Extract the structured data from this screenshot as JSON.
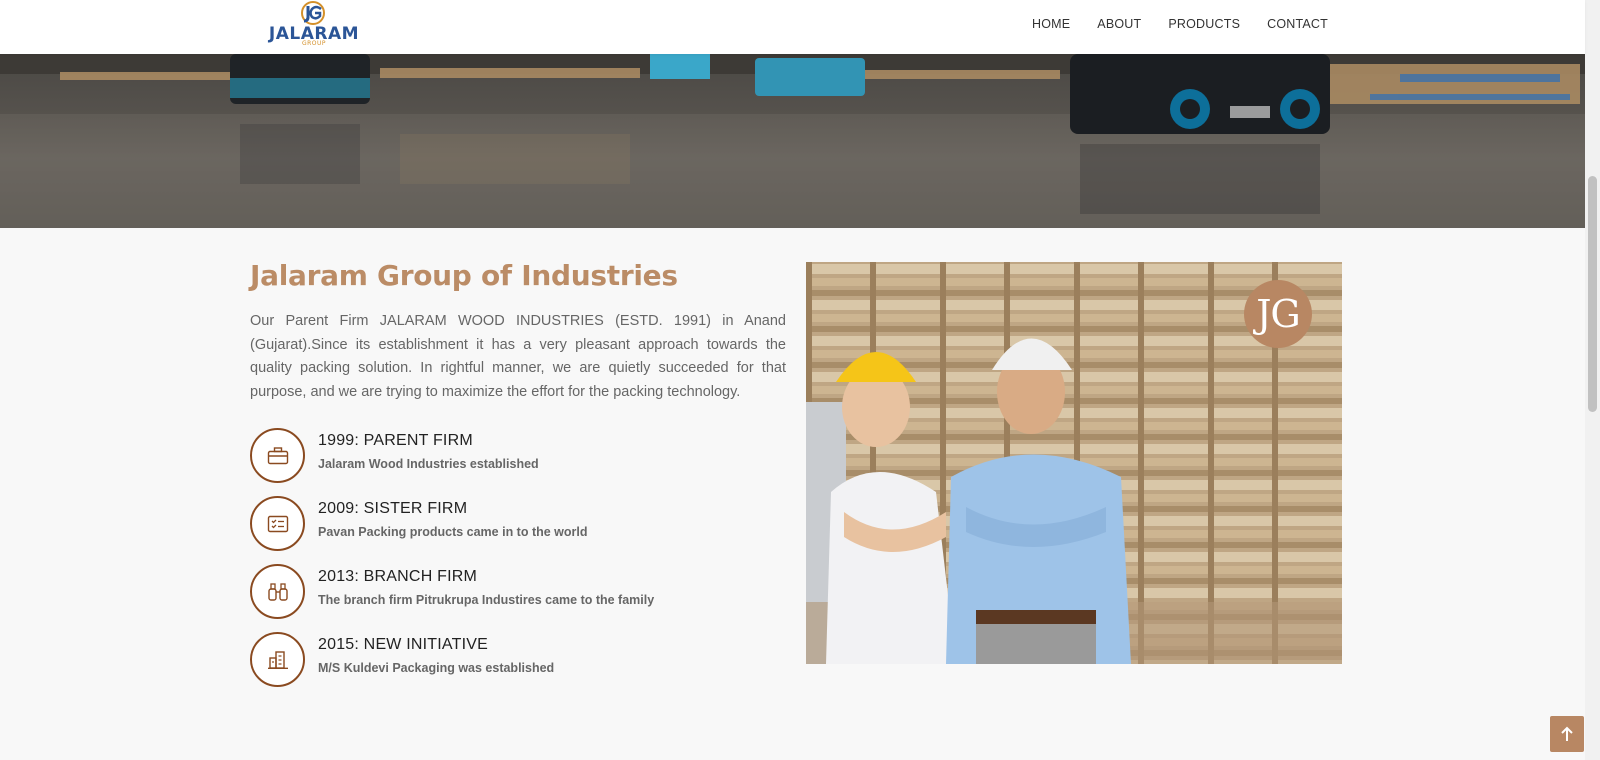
{
  "header": {
    "logo_word": "JALARAM",
    "logo_sub": "GROUP",
    "nav": [
      "HOME",
      "ABOUT",
      "PRODUCTS",
      "CONTACT"
    ]
  },
  "about": {
    "title": "Jalaram Group of Industries",
    "intro": "Our Parent Firm JALARAM WOOD INDUSTRIES (ESTD. 1991) in Anand (Gujarat).Since its establishment it has a very pleasant approach towards the quality packing solution. In rightful manner, we are quietly succeeded for that purpose, and we are trying to maximize the effort for the packing technology.",
    "milestones": [
      {
        "title": "1999: PARENT FIRM",
        "desc": "Jalaram Wood Industries established",
        "icon": "briefcase-icon"
      },
      {
        "title": "2009: SISTER FIRM",
        "desc": "Pavan Packing products came in to the world",
        "icon": "card-list-icon"
      },
      {
        "title": "2013: BRANCH FIRM",
        "desc": "The branch firm Pitrukrupa Industires came to the family",
        "icon": "binoculars-icon"
      },
      {
        "title": "2015: NEW INITIATIVE",
        "desc": "M/S Kuldevi Packaging was established",
        "icon": "building-icon"
      }
    ],
    "badge": "JG"
  },
  "colors": {
    "accent": "#bb8c66",
    "icon_border": "#8a4a20",
    "back_to_top": "#b88763"
  }
}
